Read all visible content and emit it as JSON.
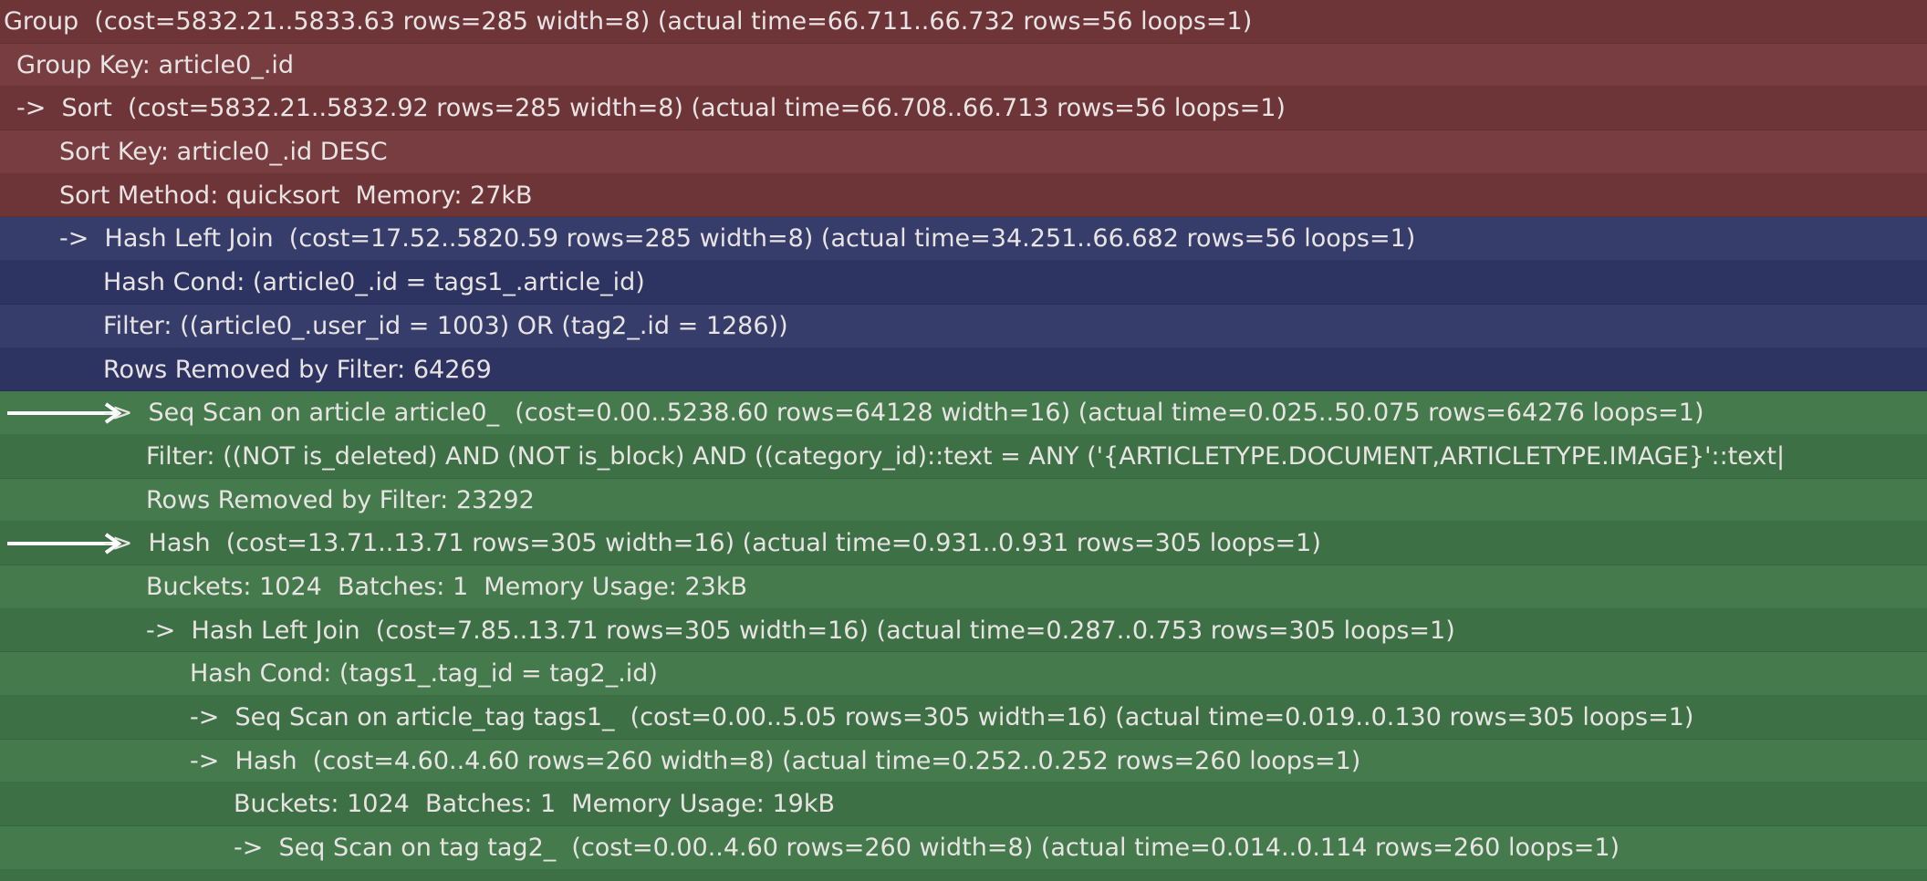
{
  "colors": {
    "red_band_a": "#6e3539",
    "red_band_b": "#773d41",
    "blue_band_a": "#2e3461",
    "blue_band_b": "#363d6b",
    "green_band_a": "#3e7045",
    "green_band_b": "#457a4c",
    "text": "#e9e4e4",
    "annotation_arrow": "#ffffff"
  },
  "plan_lines": [
    {
      "text": "Group  (cost=5832.21..5833.63 rows=285 width=8) (actual time=66.711..66.732 rows=56 loops=1)",
      "indent": 0,
      "band": "red"
    },
    {
      "text": "Group Key: article0_.id",
      "indent": 1,
      "band": "red"
    },
    {
      "text": "->  Sort  (cost=5832.21..5832.92 rows=285 width=8) (actual time=66.708..66.713 rows=56 loops=1)",
      "indent": 1,
      "band": "red"
    },
    {
      "text": "Sort Key: article0_.id DESC",
      "indent": 2,
      "band": "red"
    },
    {
      "text": "Sort Method: quicksort  Memory: 27kB",
      "indent": 2,
      "band": "red"
    },
    {
      "text": "->  Hash Left Join  (cost=17.52..5820.59 rows=285 width=8) (actual time=34.251..66.682 rows=56 loops=1)",
      "indent": 2,
      "band": "blue"
    },
    {
      "text": "Hash Cond: (article0_.id = tags1_.article_id)",
      "indent": 3,
      "band": "blue"
    },
    {
      "text": "Filter: ((article0_.user_id = 1003) OR (tag2_.id = 1286))",
      "indent": 3,
      "band": "blue"
    },
    {
      "text": "Rows Removed by Filter: 64269",
      "indent": 3,
      "band": "blue"
    },
    {
      "text": "->  Seq Scan on article article0_  (cost=0.00..5238.60 rows=64128 width=16) (actual time=0.025..50.075 rows=64276 loops=1)",
      "indent": 3,
      "band": "green",
      "arrow": true
    },
    {
      "text": "Filter: ((NOT is_deleted) AND (NOT is_block) AND ((category_id)::text = ANY ('{ARTICLETYPE.DOCUMENT,ARTICLETYPE.IMAGE}'::text|",
      "indent": 4,
      "band": "green"
    },
    {
      "text": "Rows Removed by Filter: 23292",
      "indent": 4,
      "band": "green"
    },
    {
      "text": "->  Hash  (cost=13.71..13.71 rows=305 width=16) (actual time=0.931..0.931 rows=305 loops=1)",
      "indent": 3,
      "band": "green",
      "arrow": true
    },
    {
      "text": "Buckets: 1024  Batches: 1  Memory Usage: 23kB",
      "indent": 4,
      "band": "green"
    },
    {
      "text": "->  Hash Left Join  (cost=7.85..13.71 rows=305 width=16) (actual time=0.287..0.753 rows=305 loops=1)",
      "indent": 4,
      "band": "green"
    },
    {
      "text": "Hash Cond: (tags1_.tag_id = tag2_.id)",
      "indent": 5,
      "band": "green"
    },
    {
      "text": "->  Seq Scan on article_tag tags1_  (cost=0.00..5.05 rows=305 width=16) (actual time=0.019..0.130 rows=305 loops=1)",
      "indent": 5,
      "band": "green"
    },
    {
      "text": "->  Hash  (cost=4.60..4.60 rows=260 width=8) (actual time=0.252..0.252 rows=260 loops=1)",
      "indent": 5,
      "band": "green"
    },
    {
      "text": "Buckets: 1024  Batches: 1  Memory Usage: 19kB",
      "indent": 6,
      "band": "green"
    },
    {
      "text": "->  Seq Scan on tag tag2_  (cost=0.00..4.60 rows=260 width=8) (actual time=0.014..0.114 rows=260 loops=1)",
      "indent": 6,
      "band": "green"
    }
  ]
}
